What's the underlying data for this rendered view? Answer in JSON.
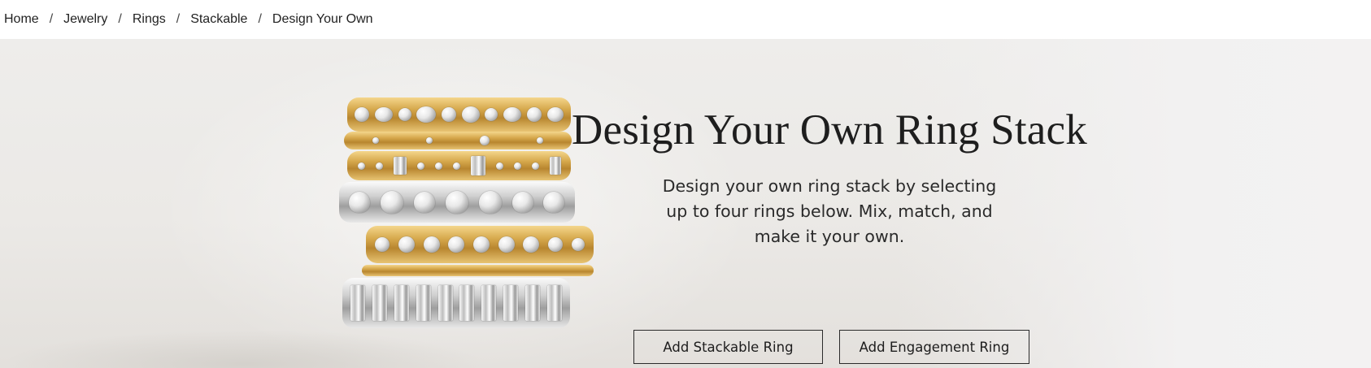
{
  "breadcrumb": {
    "items": [
      {
        "label": "Home"
      },
      {
        "label": "Jewelry"
      },
      {
        "label": "Rings"
      },
      {
        "label": "Stackable"
      }
    ],
    "separator": "/",
    "current": "Design Your Own"
  },
  "hero": {
    "title": "Design Your Own Ring Stack",
    "description": "Design your own ring stack by selecting up to four rings below. Mix, match, and make it your own.",
    "buttons": {
      "add_stackable": "Add Stackable Ring",
      "add_engagement": "Add Engagement Ring"
    },
    "image": "ring-stack-photo"
  },
  "colors": {
    "text": "#1d1d1d",
    "hero_background": "#eeedeb",
    "button_border": "#2b2b2b",
    "gold": "#d6a84c",
    "platinum": "#cfcfcf"
  }
}
